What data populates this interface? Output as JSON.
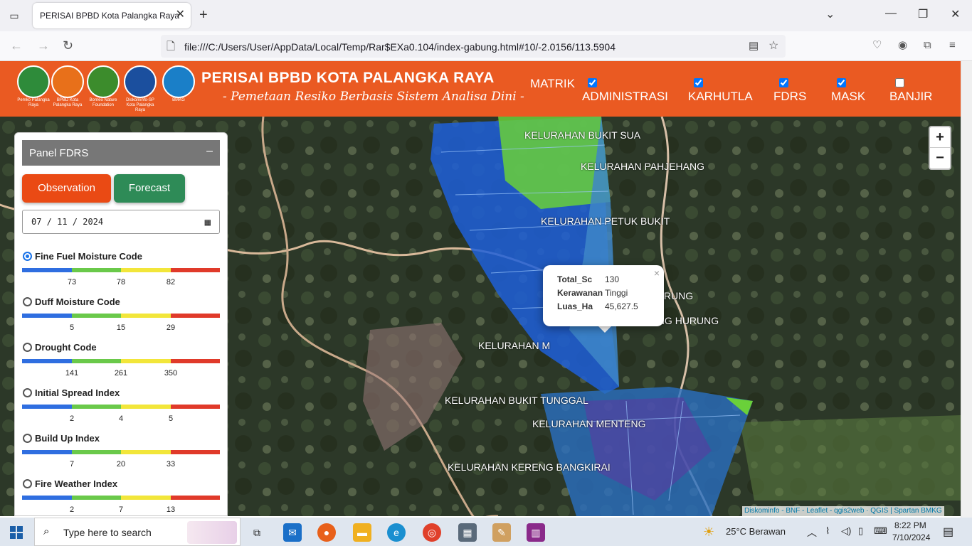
{
  "browser": {
    "tab_title": "PERISAI BPBD Kota Palangka Raya",
    "url": "file:///C:/Users/User/AppData/Local/Temp/Rar$EXa0.104/index-gabung.html#10/-2.0156/113.5904"
  },
  "header": {
    "title": "PERISAI BPBD KOTA PALANGKA RAYA",
    "subtitle": "- Pemetaan Resiko Berbasis Sistem Analisa Dini -",
    "logos": [
      {
        "caption": "Pemko Palangka Raya",
        "color": "#2e8b3a"
      },
      {
        "caption": "BPBD Kota Palangka Raya",
        "color": "#e8701a"
      },
      {
        "caption": "Borneo Nature Foundation",
        "color": "#3c8c2c"
      },
      {
        "caption": "Diskominfo-SP Kota Palangka Raya",
        "color": "#1b4f9e"
      },
      {
        "caption": "BMKG",
        "color": "#1a7fc8"
      }
    ],
    "matrik_label": "MATRIK",
    "layers": [
      {
        "label": "ADMINISTRASI",
        "checked": true
      },
      {
        "label": "KARHUTLA",
        "checked": true
      },
      {
        "label": "FDRS",
        "checked": true
      },
      {
        "label": "MASK",
        "checked": true
      },
      {
        "label": "BANJIR",
        "checked": false
      }
    ]
  },
  "panel": {
    "title": "Panel FDRS",
    "min_symbol": "–",
    "observation_label": "Observation",
    "forecast_label": "Forecast",
    "date_value": "07 / 11 / 2024",
    "indices": [
      {
        "label": "Fine Fuel Moisture Code",
        "selected": true,
        "ticks": [
          "73",
          "78",
          "82"
        ]
      },
      {
        "label": "Duff Moisture Code",
        "selected": false,
        "ticks": [
          "5",
          "15",
          "29"
        ]
      },
      {
        "label": "Drought Code",
        "selected": false,
        "ticks": [
          "141",
          "261",
          "350"
        ]
      },
      {
        "label": "Initial Spread Index",
        "selected": false,
        "ticks": [
          "2",
          "4",
          "5"
        ]
      },
      {
        "label": "Build Up Index",
        "selected": false,
        "ticks": [
          "7",
          "20",
          "33"
        ]
      },
      {
        "label": "Fire Weather Index",
        "selected": false,
        "ticks": [
          "2",
          "7",
          "13"
        ]
      }
    ],
    "scale_colors": [
      "#2f6ee0",
      "#6ac94a",
      "#f2e63a",
      "#e03a2a"
    ]
  },
  "map": {
    "labels": [
      "KELURAHAN BUKIT SUA",
      "KELURAHAN PAHJEHANG",
      "KELURAHAN PETUK BUKIT",
      "KELURAHAN BANTURUNG",
      "KELURAHAN HABARUNG HURUNG",
      "KELURAHAN M",
      "KELURAHAN BUKIT TUNGGAL",
      "KELURAHAN MENTENG",
      "KELURAHAN KERENG BANGKIRAI"
    ],
    "zoom_in": "+",
    "zoom_out": "−",
    "attribution": "Diskominfo - BNF - Leaflet - qgis2web · QGIS | Spartan BMKG",
    "popup": {
      "close": "×",
      "rows": [
        {
          "key": "Total_Sc",
          "value": "130"
        },
        {
          "key": "Kerawanan",
          "value": "Tinggi"
        },
        {
          "key": "Luas_Ha",
          "value": "45,627.5"
        }
      ]
    }
  },
  "taskbar": {
    "search_placeholder": "Type here to search",
    "weather": "25°C  Berawan",
    "time": "8:22 PM",
    "date": "7/10/2024"
  }
}
